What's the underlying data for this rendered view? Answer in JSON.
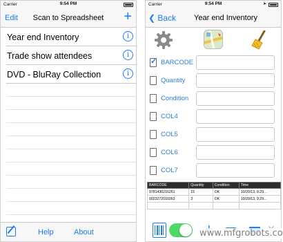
{
  "left": {
    "status": {
      "carrier": "Carrier",
      "time": "9:54 PM"
    },
    "nav": {
      "edit": "Edit",
      "title": "Scan to Spreadsheet",
      "add": "+"
    },
    "lists": [
      {
        "label": "Year end Inventory"
      },
      {
        "label": "Trade show attendees"
      },
      {
        "label": "DVD - BluRay Collection"
      }
    ],
    "toolbar": {
      "help": "Help",
      "about": "About"
    }
  },
  "right": {
    "status": {
      "carrier": "Carrier",
      "time": "9:54 PM"
    },
    "nav": {
      "back": "Back",
      "title": "Year end Inventory"
    },
    "fields": [
      {
        "label": "BARCODE",
        "checked": true
      },
      {
        "label": "Quantity",
        "checked": false
      },
      {
        "label": "Condition",
        "checked": false
      },
      {
        "label": "COL4",
        "checked": false
      },
      {
        "label": "COL5",
        "checked": false
      },
      {
        "label": "COL6",
        "checked": false
      },
      {
        "label": "COL7",
        "checked": false
      }
    ],
    "table": {
      "headers": [
        "BARCODE",
        "Quantity",
        "Condition",
        "Time"
      ],
      "rows": [
        [
          "9781430216261",
          "15",
          "OK",
          "10/20/13, 9:29..."
        ],
        [
          "0023272010263",
          "3",
          "OK",
          "10/20/13, 9:29..."
        ],
        [
          "",
          "",
          "",
          ""
        ]
      ]
    },
    "toolbar": {
      "add": "+",
      "close": "✕",
      "toggle_on": true
    }
  },
  "watermark": "www.mfgrobots.com",
  "colors": {
    "accent": "#1a7cf5",
    "toggle": "#4cd964",
    "header_dark": "#2d2d2d"
  }
}
